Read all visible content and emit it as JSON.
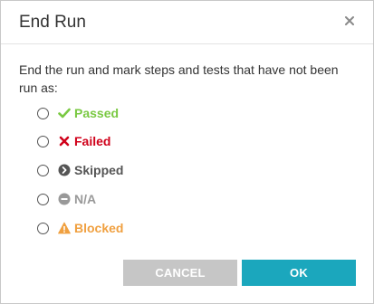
{
  "dialog": {
    "title": "End Run",
    "prompt": "End the run and mark steps and tests that have not been run as:"
  },
  "options": [
    {
      "label": "Passed",
      "icon": "check-icon",
      "color": "#7ac943"
    },
    {
      "label": "Failed",
      "icon": "x-icon",
      "color": "#d0021b"
    },
    {
      "label": "Skipped",
      "icon": "chevron-right-circle-icon",
      "color": "#555555"
    },
    {
      "label": "N/A",
      "icon": "minus-circle-icon",
      "color": "#999999"
    },
    {
      "label": "Blocked",
      "icon": "warning-icon",
      "color": "#f0a040"
    }
  ],
  "buttons": {
    "cancel_label": "CANCEL",
    "ok_label": "OK"
  },
  "colors": {
    "ok_button": "#1ba7bd",
    "cancel_button": "#c6c6c6"
  }
}
